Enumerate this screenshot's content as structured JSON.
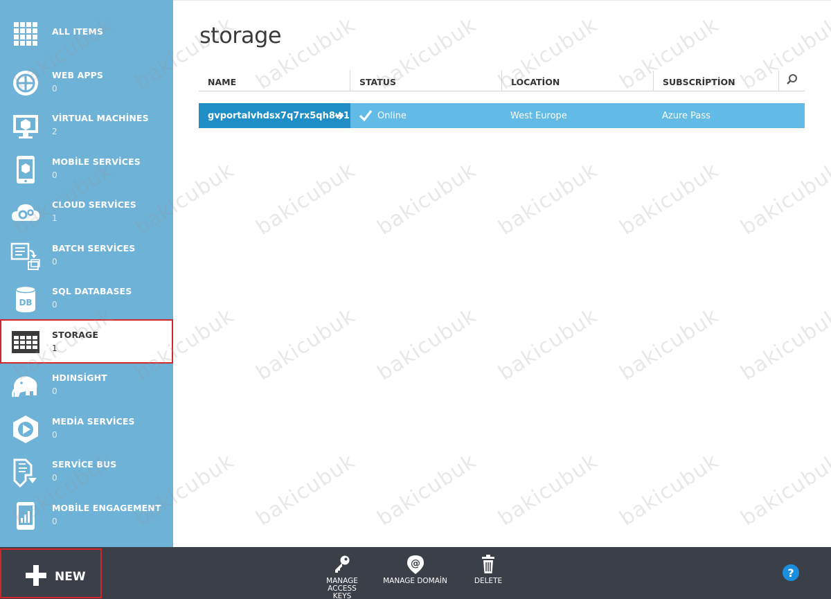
{
  "sidebar": {
    "items": [
      {
        "label": "ALL ITEMS",
        "count": "",
        "icon": "grid-icon"
      },
      {
        "label": "WEB APPS",
        "count": "0",
        "icon": "globe-icon"
      },
      {
        "label": "VİRTUAL MACHİNES",
        "count": "2",
        "icon": "monitor-icon"
      },
      {
        "label": "MOBİLE SERVİCES",
        "count": "0",
        "icon": "phone-icon"
      },
      {
        "label": "CLOUD SERVİCES",
        "count": "1",
        "icon": "cloud-gear-icon"
      },
      {
        "label": "BATCH SERVİCES",
        "count": "0",
        "icon": "batch-icon"
      },
      {
        "label": "SQL DATABASES",
        "count": "0",
        "icon": "database-icon"
      },
      {
        "label": "STORAGE",
        "count": "1",
        "icon": "storage-table-icon",
        "active": true
      },
      {
        "label": "HDINSİGHT",
        "count": "0",
        "icon": "elephant-icon"
      },
      {
        "label": "MEDİA SERVİCES",
        "count": "0",
        "icon": "media-play-icon"
      },
      {
        "label": "SERVİCE BUS",
        "count": "0",
        "icon": "service-bus-icon"
      },
      {
        "label": "MOBİLE ENGAGEMENT",
        "count": "0",
        "icon": "mobile-engagement-icon"
      }
    ]
  },
  "main": {
    "title": "storage",
    "columns": [
      "NAME",
      "STATUS",
      "LOCATİON",
      "SUBSCRİPTİON"
    ],
    "rows": [
      {
        "name": "gvportalvhdsx7q7rx5qh8w1",
        "status": "Online",
        "location": "West Europe",
        "subscription": "Azure Pass"
      }
    ]
  },
  "bottombar": {
    "new_label": "NEW",
    "commands": [
      {
        "label_line1": "MANAGE ACCESS",
        "label_line2": "KEYS",
        "icon": "key-icon"
      },
      {
        "label_line1": "MANAGE DOMAİN",
        "label_line2": "",
        "icon": "at-sign-icon"
      },
      {
        "label_line1": "DELETE",
        "label_line2": "",
        "icon": "trash-icon"
      }
    ],
    "help_label": "?"
  },
  "watermark": "bakicubuk",
  "colors": {
    "sidebar_bg": "#6eb2d8",
    "row_bg": "#62bbe6",
    "row_name_bg": "#1f8ec7",
    "bottombar_bg": "#3b3f47",
    "highlight_border": "#d3262c",
    "help_blue": "#1a8fe0"
  }
}
